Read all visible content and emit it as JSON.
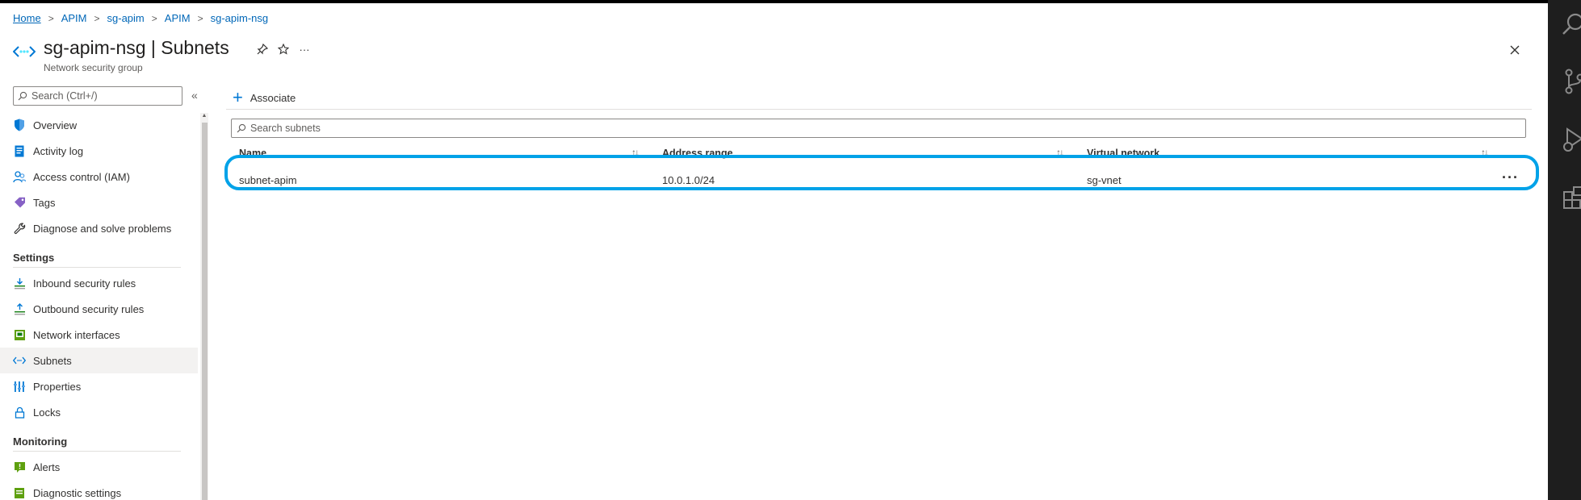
{
  "breadcrumb": {
    "items": [
      {
        "label": "Home"
      },
      {
        "label": "APIM"
      },
      {
        "label": "sg-apim"
      },
      {
        "label": "APIM"
      },
      {
        "label": "sg-apim-nsg"
      }
    ]
  },
  "header": {
    "title": "sg-apim-nsg | Subnets",
    "subtitle": "Network security group",
    "more_label": "···"
  },
  "nav": {
    "search_placeholder": "Search (Ctrl+/)",
    "collapse_label": "«",
    "items_top": [
      {
        "label": "Overview",
        "icon": "shield-icon"
      },
      {
        "label": "Activity log",
        "icon": "log-icon"
      },
      {
        "label": "Access control (IAM)",
        "icon": "people-icon"
      },
      {
        "label": "Tags",
        "icon": "tag-icon"
      },
      {
        "label": "Diagnose and solve problems",
        "icon": "wrench-icon"
      }
    ],
    "sections": [
      {
        "title": "Settings",
        "items": [
          {
            "label": "Inbound security rules",
            "icon": "inbound-icon"
          },
          {
            "label": "Outbound security rules",
            "icon": "outbound-icon"
          },
          {
            "label": "Network interfaces",
            "icon": "nic-icon"
          },
          {
            "label": "Subnets",
            "icon": "subnet-icon",
            "selected": true
          },
          {
            "label": "Properties",
            "icon": "properties-icon"
          },
          {
            "label": "Locks",
            "icon": "lock-icon"
          }
        ]
      },
      {
        "title": "Monitoring",
        "items": [
          {
            "label": "Alerts",
            "icon": "alert-icon"
          },
          {
            "label": "Diagnostic settings",
            "icon": "diagnostic-icon"
          }
        ]
      }
    ]
  },
  "toolbar": {
    "associate_label": "Associate"
  },
  "grid": {
    "search_placeholder": "Search subnets",
    "columns": [
      {
        "label": "Name"
      },
      {
        "label": "Address range"
      },
      {
        "label": "Virtual network"
      }
    ],
    "sort_symbol": "↑↓",
    "rows": [
      {
        "name": "subnet-apim",
        "address_range": "10.0.1.0/24",
        "virtual_network": "sg-vnet",
        "more_label": "···"
      }
    ]
  },
  "colors": {
    "accent": "#0078d4",
    "link": "#0067b8",
    "highlight": "#00a2e8",
    "rail": "#1e1e1e"
  }
}
